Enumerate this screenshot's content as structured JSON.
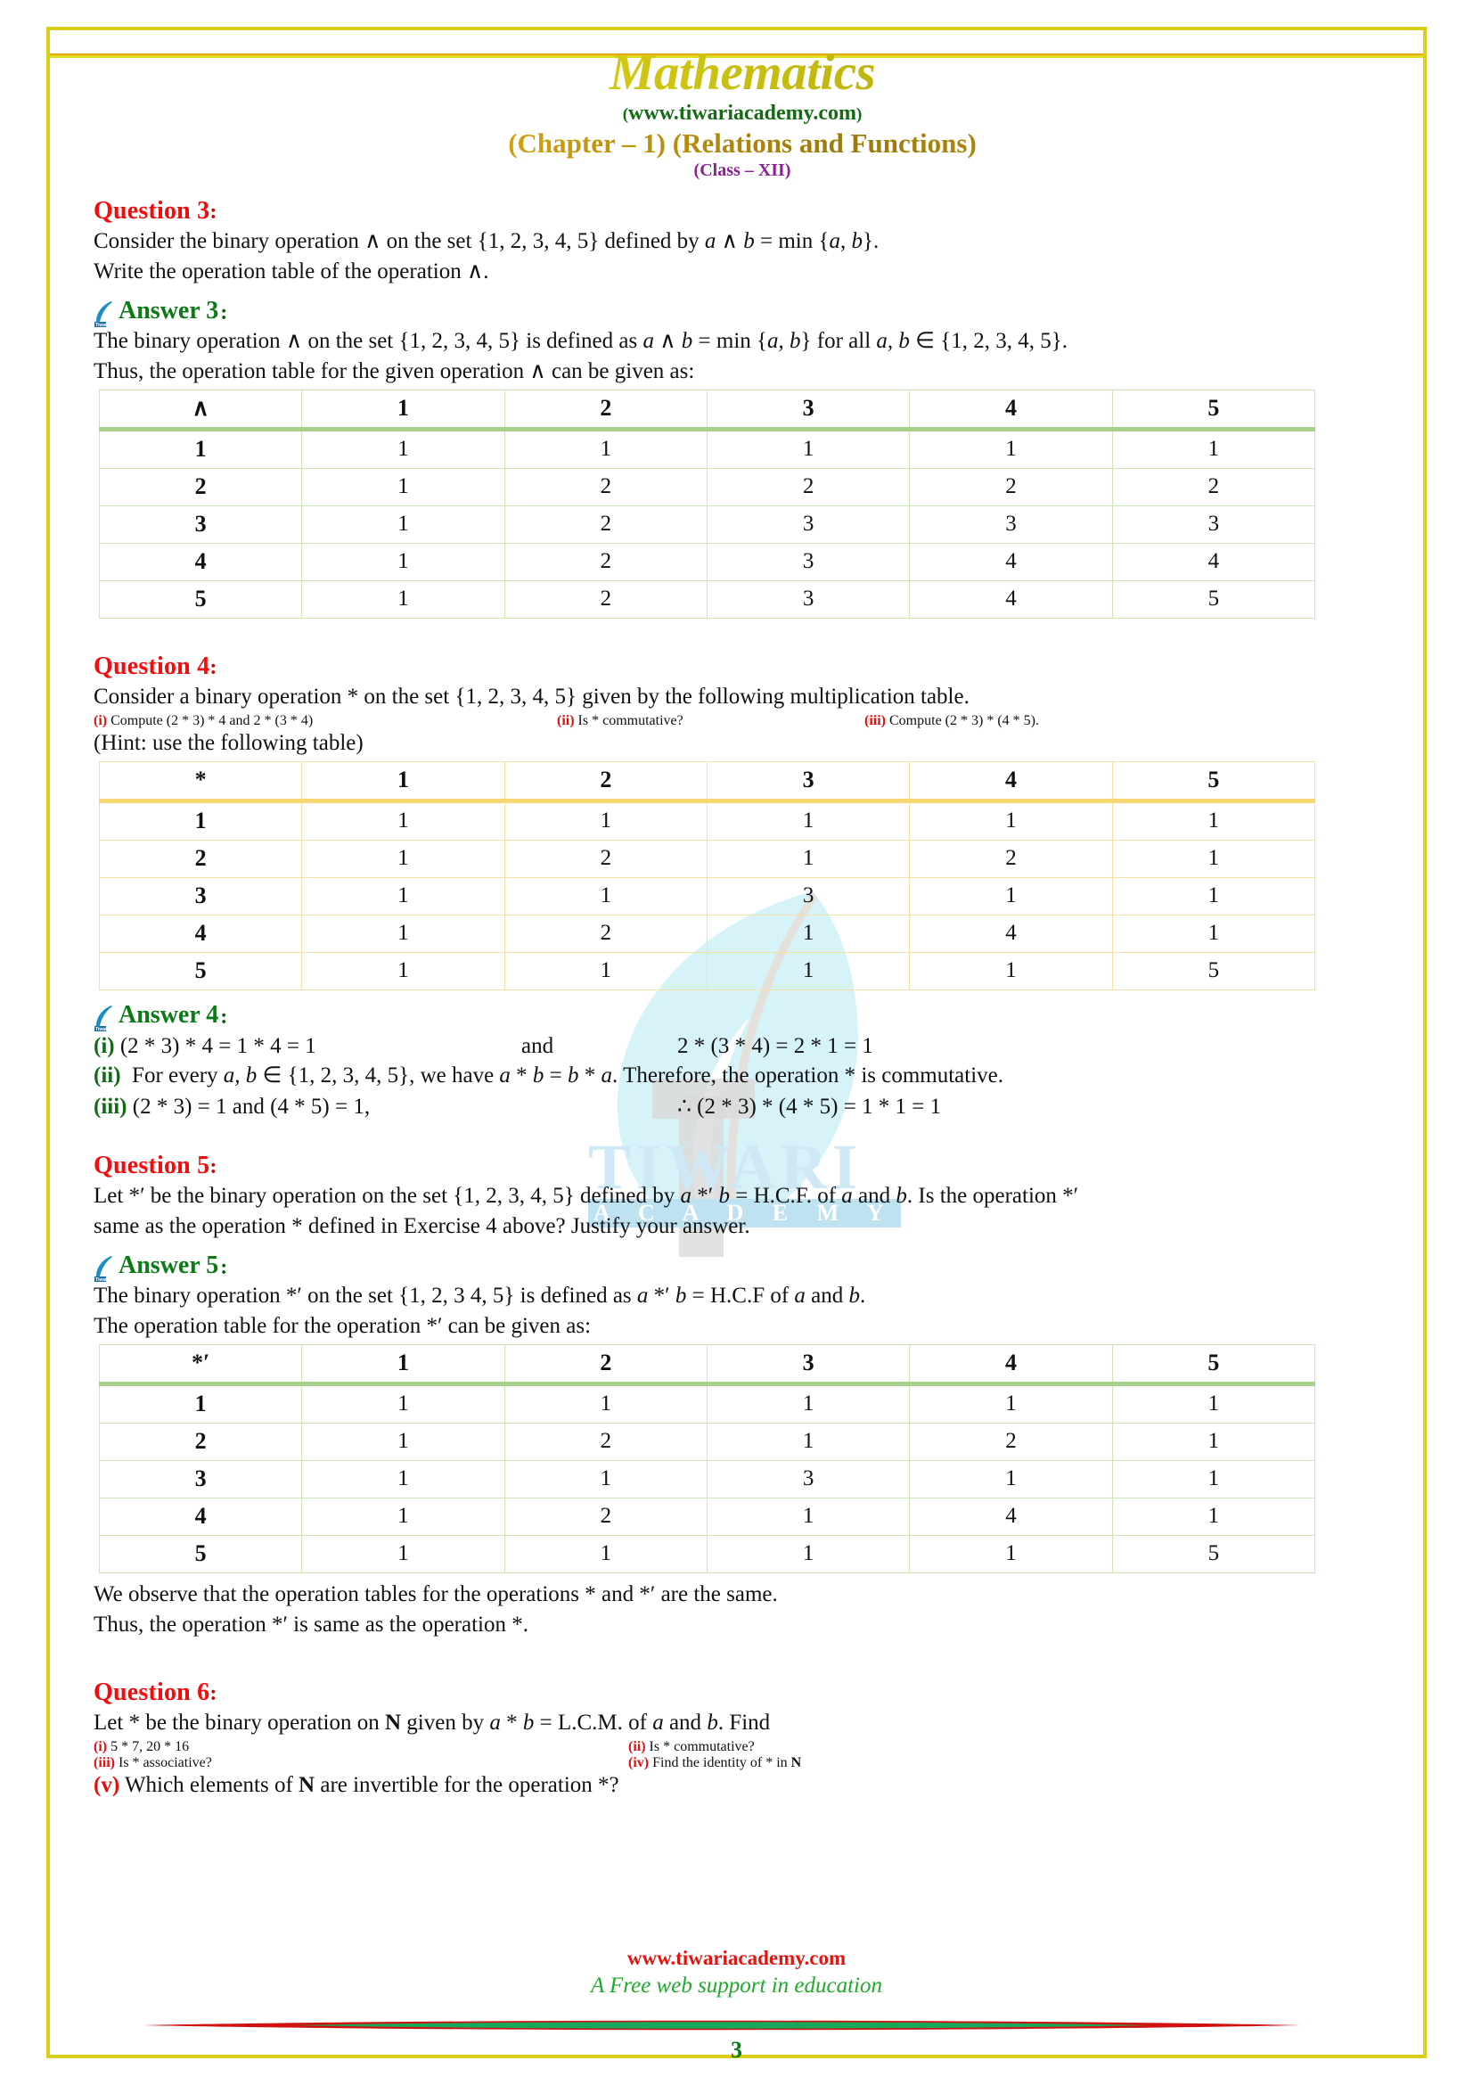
{
  "header": {
    "title": "Mathematics",
    "site": "www.tiwariacademy.com",
    "site_open": "(",
    "site_close": ")",
    "chapter": "(Chapter – 1) (Relations and Functions)",
    "class": "(Class – XII)"
  },
  "watermark": {
    "main": "TIWARI",
    "sub": "A C A D E M Y",
    "leaf_icon": "leaf-icon"
  },
  "q3": {
    "heading": "Question 3",
    "colon": ":",
    "line1": "Consider the binary operation ∧ on the set {1, 2, 3, 4, 5} defined by ",
    "line1_italic_a": "a",
    "line1_mid": " ∧ ",
    "line1_italic_b": "b",
    "line1_end": " = min {",
    "line1_a2": "a",
    "line1_comma": ", ",
    "line1_b2": "b",
    "line1_close": "}.",
    "line2": "Write the operation table of the operation ∧."
  },
  "a3": {
    "heading": "Answer 3",
    "colon": ":",
    "line1_p1": "The binary operation ∧ on the set {1, 2, 3, 4, 5} is defined as ",
    "line1_a": "a",
    "line1_p2": " ∧ ",
    "line1_b": "b",
    "line1_p3": " = min {",
    "line1_a2": "a",
    "line1_p4": ", ",
    "line1_b2": "b",
    "line1_p5": "} for all ",
    "line1_a3": "a, b",
    "line1_p6": " ∈ {1, 2, 3, 4, 5}.",
    "line2": "Thus, the operation table for the given operation ∧ can be given as:"
  },
  "table1": {
    "style": "green",
    "corner": "∧",
    "columns": [
      "1",
      "2",
      "3",
      "4",
      "5"
    ],
    "rows": [
      {
        "head": "1",
        "cells": [
          "1",
          "1",
          "1",
          "1",
          "1"
        ]
      },
      {
        "head": "2",
        "cells": [
          "1",
          "2",
          "2",
          "2",
          "2"
        ]
      },
      {
        "head": "3",
        "cells": [
          "1",
          "2",
          "3",
          "3",
          "3"
        ]
      },
      {
        "head": "4",
        "cells": [
          "1",
          "2",
          "3",
          "4",
          "4"
        ]
      },
      {
        "head": "5",
        "cells": [
          "1",
          "2",
          "3",
          "4",
          "5"
        ]
      }
    ]
  },
  "q4": {
    "heading": "Question 4",
    "colon": ":",
    "line1": "Consider a binary operation * on the set {1, 2, 3, 4, 5} given by the following multiplication table.",
    "part_i_label": "(i)",
    "part_i_text": " Compute (2 * 3) * 4 and 2 * (3 * 4)",
    "part_ii_label": "(ii)",
    "part_ii_text": " Is * commutative?",
    "part_iii_label": "(iii)",
    "part_iii_text": " Compute (2 * 3) * (4 * 5).",
    "hint": "(Hint: use the following table)"
  },
  "table2": {
    "style": "amber",
    "corner": "*",
    "columns": [
      "1",
      "2",
      "3",
      "4",
      "5"
    ],
    "rows": [
      {
        "head": "1",
        "cells": [
          "1",
          "1",
          "1",
          "1",
          "1"
        ]
      },
      {
        "head": "2",
        "cells": [
          "1",
          "2",
          "1",
          "2",
          "1"
        ]
      },
      {
        "head": "3",
        "cells": [
          "1",
          "1",
          "3",
          "1",
          "1"
        ]
      },
      {
        "head": "4",
        "cells": [
          "1",
          "2",
          "1",
          "4",
          "1"
        ]
      },
      {
        "head": "5",
        "cells": [
          "1",
          "1",
          "1",
          "1",
          "5"
        ]
      }
    ]
  },
  "a4": {
    "heading": "Answer 4",
    "colon": ":",
    "i_label": "(i)",
    "i_left": " (2 * 3) * 4 = 1 * 4 = 1",
    "i_and": "and",
    "i_right": "2 * (3 * 4) = 2 * 1 = 1",
    "ii_label": "(ii)",
    "ii_p1": "  For every ",
    "ii_ab": "a, b",
    "ii_p2": " ∈ {1, 2, 3, 4, 5}, we have ",
    "ii_expr1": "a",
    "ii_p3": " * ",
    "ii_expr2": "b",
    "ii_p4": " = ",
    "ii_expr3": "b",
    "ii_p5": " * ",
    "ii_expr4": "a",
    "ii_p6": ". Therefore, the operation * is commutative.",
    "iii_label": "(iii)",
    "iii_left": "  (2 * 3) = 1 and (4 * 5) = 1,",
    "iii_right": "∴ (2 * 3) * (4 * 5) = 1 * 1 = 1"
  },
  "q5": {
    "heading": "Question 5",
    "colon": ":",
    "line1_p1": "Let *",
    "line1_prime": "′",
    "line1_p2": " be the binary operation on the set {1, 2, 3, 4, 5} defined by ",
    "line1_a": "a",
    "line1_op": " *′ ",
    "line1_b": "b",
    "line1_p3": " = H.C.F. of ",
    "line1_a2": "a",
    "line1_p4": " and ",
    "line1_b2": "b",
    "line1_p5": ". Is the operation *′",
    "line2": "same as the operation * defined in Exercise 4 above? Justify your answer."
  },
  "a5": {
    "heading": "Answer 5",
    "colon": ":",
    "line1_p1": "The binary operation *′ on the set {1, 2, 3 4, 5} is defined as ",
    "line1_a": "a",
    "line1_op": " *′ ",
    "line1_b": "b",
    "line1_p2": " = H.C.F of ",
    "line1_a2": "a",
    "line1_p3": " and ",
    "line1_b2": "b",
    "line1_p4": ".",
    "line2": "The operation table for the operation *′ can be given as:",
    "concl1": "We observe that the operation tables for the operations * and *′ are the same.",
    "concl2": "Thus, the operation *′ is same as the operation *."
  },
  "table3": {
    "style": "green",
    "corner": "*′",
    "columns": [
      "1",
      "2",
      "3",
      "4",
      "5"
    ],
    "rows": [
      {
        "head": "1",
        "cells": [
          "1",
          "1",
          "1",
          "1",
          "1"
        ]
      },
      {
        "head": "2",
        "cells": [
          "1",
          "2",
          "1",
          "2",
          "1"
        ]
      },
      {
        "head": "3",
        "cells": [
          "1",
          "1",
          "3",
          "1",
          "1"
        ]
      },
      {
        "head": "4",
        "cells": [
          "1",
          "2",
          "1",
          "4",
          "1"
        ]
      },
      {
        "head": "5",
        "cells": [
          "1",
          "1",
          "1",
          "1",
          "5"
        ]
      }
    ]
  },
  "q6": {
    "heading": "Question 6",
    "colon": ":",
    "line1_p1": "Let * be the binary operation on ",
    "line1_N": "N",
    "line1_p2": " given by ",
    "line1_a": "a",
    "line1_p3": " * ",
    "line1_b": "b",
    "line1_p4": " = L.C.M. of ",
    "line1_a2": "a",
    "line1_p5": " and ",
    "line1_b2": "b",
    "line1_p6": ". Find",
    "i_label": "(i)",
    "i_text": " 5 * 7, 20 * 16",
    "ii_label": "(ii)",
    "ii_text": " Is * commutative?",
    "iii_label": "(iii)",
    "iii_text": " Is * associative?",
    "iv_label": "(iv)",
    "iv_text_p1": " Find the identity of * in ",
    "iv_N": "N",
    "v_label": "(v)",
    "v_text_p1": " Which elements of ",
    "v_N": "N",
    "v_text_p2": " are invertible for the operation *?"
  },
  "footer": {
    "site": "www.tiwariacademy.com",
    "tagline": "A Free web support in education",
    "page_number": "3"
  },
  "colors": {
    "frame": "#d9cf1a",
    "question": "#f20c0c",
    "answer": "#0c7a16",
    "title": "#d7cd12",
    "chapter": "#e0a60d",
    "class": "#8c1f95",
    "table_green": "#a7d18a",
    "table_amber": "#f6d573",
    "footer_site": "#e2140f",
    "footer_tag": "#1faa2a"
  }
}
